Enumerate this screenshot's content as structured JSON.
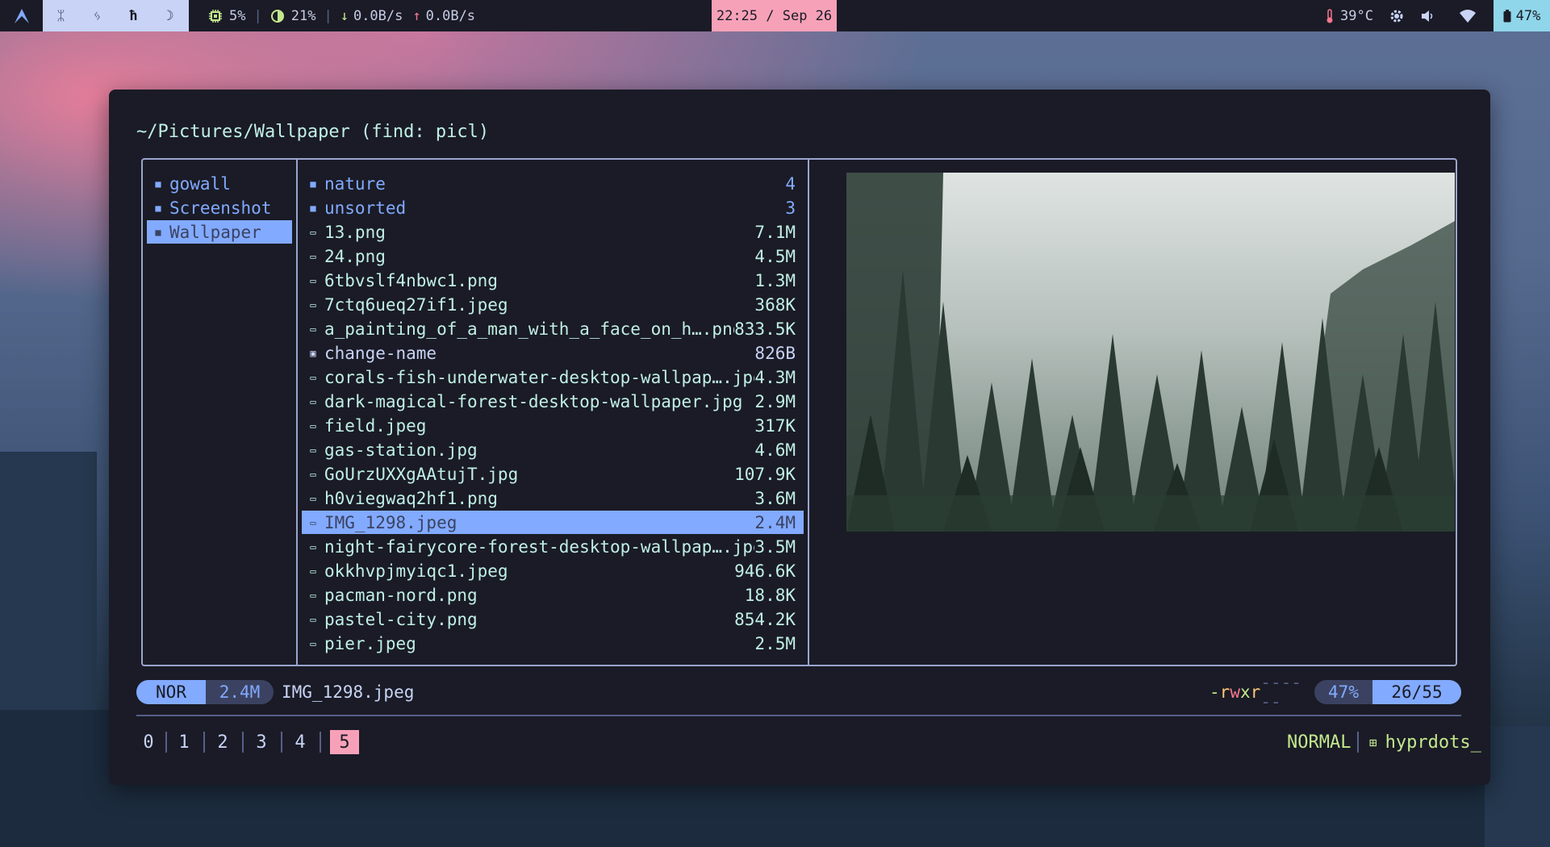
{
  "topbar": {
    "logo_icon": "arch-logo-icon",
    "workspaces": [
      "ᛯ",
      "ᛃ",
      "ħ",
      "☽"
    ],
    "cpu": "5%",
    "memory": "21%",
    "net_down": "0.0B/s",
    "net_up": "0.0B/s",
    "clock": "22:25 / Sep 26",
    "temperature": "39°C",
    "battery": "47%",
    "colors": {
      "bar_bg": "#1a1b26",
      "clock_bg": "#f7a1b8",
      "battery_bg": "#8fd6ea",
      "workspaces_bg": "#c8d3f5"
    }
  },
  "yazi": {
    "path": "~/Pictures/Wallpaper (find: picl)",
    "parent": [
      {
        "name": "gowall",
        "type": "dir"
      },
      {
        "name": "Screenshot",
        "type": "dir"
      },
      {
        "name": "Wallpaper",
        "type": "dir",
        "selected": true
      }
    ],
    "files": [
      {
        "name": "nature",
        "size": "4",
        "type": "dir"
      },
      {
        "name": "unsorted",
        "size": "3",
        "type": "dir"
      },
      {
        "name": "13.png",
        "size": "7.1M",
        "type": "image"
      },
      {
        "name": "24.png",
        "size": "4.5M",
        "type": "image"
      },
      {
        "name": "6tbvslf4nbwc1.png",
        "size": "1.3M",
        "type": "image"
      },
      {
        "name": "7ctq6ueq27if1.jpeg",
        "size": "368K",
        "type": "image"
      },
      {
        "name": "a_painting_of_a_man_with_a_face_on_h….png",
        "size": "833.5K",
        "type": "image"
      },
      {
        "name": "change-name",
        "size": "826B",
        "type": "script"
      },
      {
        "name": "corals-fish-underwater-desktop-wallpap….jpg",
        "size": "4.3M",
        "type": "image"
      },
      {
        "name": "dark-magical-forest-desktop-wallpaper.jpg",
        "size": "2.9M",
        "type": "image"
      },
      {
        "name": "field.jpeg",
        "size": "317K",
        "type": "image"
      },
      {
        "name": "gas-station.jpg",
        "size": "4.6M",
        "type": "image"
      },
      {
        "name": "GoUrzUXXgAAtujT.jpg",
        "size": "107.9K",
        "type": "image"
      },
      {
        "name": "h0viegwaq2hf1.png",
        "size": "3.6M",
        "type": "image"
      },
      {
        "name": "IMG_1298.jpeg",
        "size": "2.4M",
        "type": "image",
        "selected": true
      },
      {
        "name": "night-fairycore-forest-desktop-wallpap….jpg",
        "size": "3.5M",
        "type": "image"
      },
      {
        "name": "okkhvpjmyiqc1.jpeg",
        "size": "946.6K",
        "type": "image"
      },
      {
        "name": "pacman-nord.png",
        "size": "18.8K",
        "type": "image"
      },
      {
        "name": "pastel-city.png",
        "size": "854.2K",
        "type": "image"
      },
      {
        "name": "pier.jpeg",
        "size": "2.5M",
        "type": "image"
      }
    ],
    "status": {
      "mode": "NOR",
      "size": "2.4M",
      "filename": "IMG_1298.jpeg",
      "perm_1": "-",
      "perm_r": "r",
      "perm_w": "w",
      "perm_x": "x",
      "perm_r2": "r",
      "perm_rest": "------",
      "percent": "47%",
      "position": "26/55"
    },
    "colors": {
      "dir": "#82aaff",
      "file": "#c0efe4",
      "selection": "#82aaff",
      "border": "#9aa5ce"
    }
  },
  "tmux": {
    "tabs": [
      "0",
      "1",
      "2",
      "3",
      "4",
      "5"
    ],
    "active_tab": "5",
    "mode": "NORMAL",
    "session": "hyprdots_",
    "colors": {
      "active_tab_bg": "#f7a1b8",
      "mode": "#c3e88d"
    }
  }
}
